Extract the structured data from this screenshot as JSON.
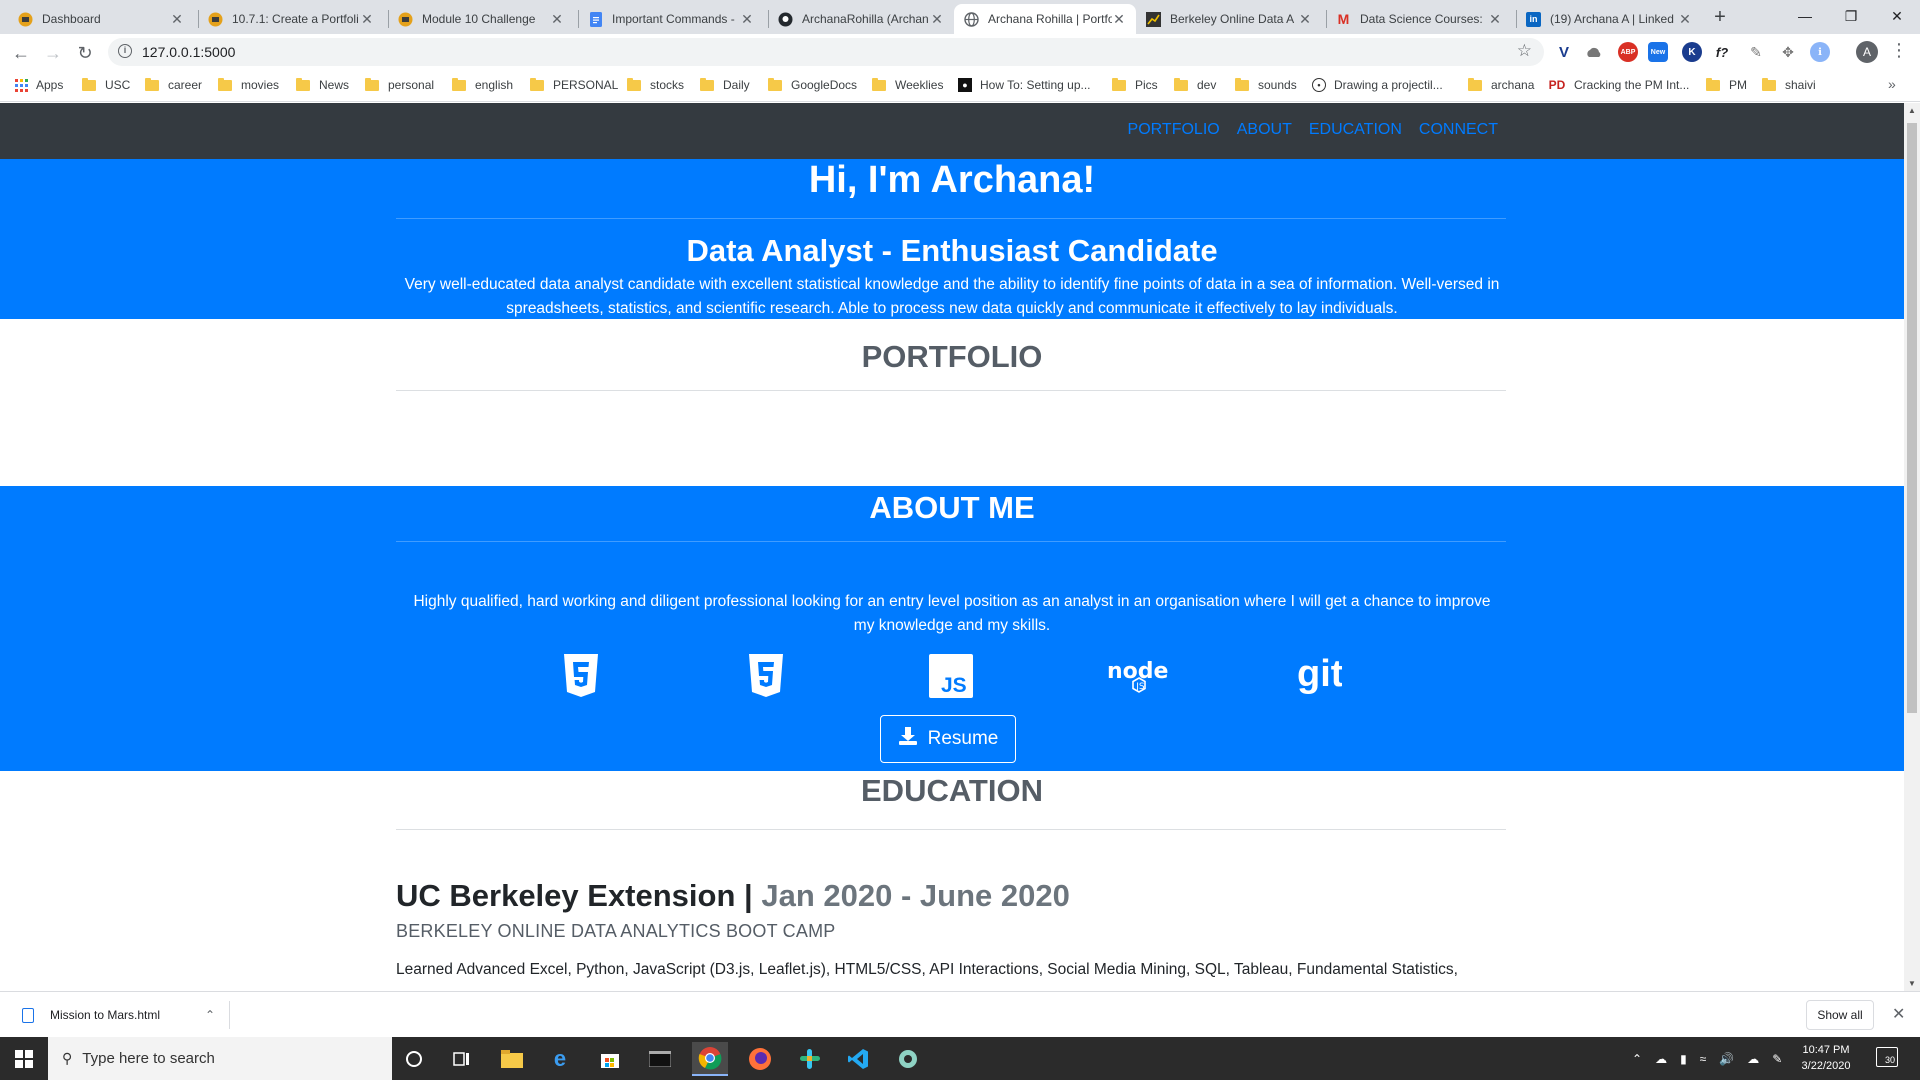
{
  "browser": {
    "tabs": [
      {
        "label": "Dashboard",
        "icon": "canvas-icon",
        "active": false
      },
      {
        "label": "10.7.1: Create a Portfoli",
        "icon": "canvas-icon",
        "active": false
      },
      {
        "label": "Module 10 Challenge",
        "icon": "canvas-icon",
        "active": false
      },
      {
        "label": "Important Commands -",
        "icon": "google-docs-icon",
        "active": false
      },
      {
        "label": "ArchanaRohilla (Archan",
        "icon": "github-icon",
        "active": false
      },
      {
        "label": "Archana Rohilla | Portfo",
        "icon": "globe-icon",
        "active": true
      },
      {
        "label": "Berkeley Online Data A",
        "icon": "chart-icon",
        "active": false
      },
      {
        "label": "Data Science Courses:",
        "icon": "gmail-icon",
        "active": false
      },
      {
        "label": "(19) Archana A | Linked",
        "icon": "linkedin-icon",
        "active": false
      }
    ],
    "url": "127.0.0.1:5000",
    "profile_initial": "A",
    "bookmarks": [
      {
        "label": "Apps",
        "type": "apps"
      },
      {
        "label": "USC",
        "type": "folder"
      },
      {
        "label": "career",
        "type": "folder"
      },
      {
        "label": "movies",
        "type": "folder"
      },
      {
        "label": "News",
        "type": "folder"
      },
      {
        "label": "personal",
        "type": "folder"
      },
      {
        "label": "english",
        "type": "folder"
      },
      {
        "label": "PERSONAL",
        "type": "folder"
      },
      {
        "label": "stocks",
        "type": "folder"
      },
      {
        "label": "Daily",
        "type": "folder"
      },
      {
        "label": "GoogleDocs",
        "type": "folder"
      },
      {
        "label": "Weeklies",
        "type": "folder"
      },
      {
        "label": "How To: Setting up...",
        "type": "page"
      },
      {
        "label": "Pics",
        "type": "folder"
      },
      {
        "label": "dev",
        "type": "folder"
      },
      {
        "label": "sounds",
        "type": "folder"
      },
      {
        "label": "Drawing a projectil...",
        "type": "page"
      },
      {
        "label": "archana",
        "type": "folder"
      },
      {
        "label": "Cracking the PM Int...",
        "type": "page"
      },
      {
        "label": "PM",
        "type": "folder"
      },
      {
        "label": "shaivi",
        "type": "folder"
      }
    ]
  },
  "site": {
    "nav": [
      "PORTFOLIO",
      "ABOUT",
      "EDUCATION",
      "CONNECT"
    ],
    "hero": {
      "greeting": "Hi, I'm Archana!",
      "role": "Data Analyst - Enthusiast Candidate",
      "summary": "Very well-educated data analyst candidate with excellent statistical knowledge and the ability to identify fine points of data in a sea of information. Well-versed in spreadsheets, statistics, and scientific research. Able to process new data quickly and communicate it effectively to lay individuals."
    },
    "portfolio": {
      "title": "PORTFOLIO"
    },
    "about": {
      "title": "ABOUT ME",
      "text": "Highly qualified, hard working and diligent professional looking for an entry level position as an analyst in an organisation where I will get a chance to improve my knowledge and my skills.",
      "skills": [
        "html5-icon",
        "css3-icon",
        "js-icon",
        "node-icon",
        "git-icon"
      ],
      "resume_label": "Resume"
    },
    "education": {
      "title": "EDUCATION",
      "school": "UC Berkeley Extension",
      "separator": "|",
      "dates": "Jan 2020 - June 2020",
      "program": "BERKELEY ONLINE DATA ANALYTICS BOOT CAMP",
      "description": "Learned Advanced Excel, Python, JavaScript (D3.js, Leaflet.js), HTML5/CSS, API Interactions, Social Media Mining, SQL, Tableau, Fundamental Statistics,"
    }
  },
  "downloads": {
    "file": "Mission to Mars.html",
    "show_all": "Show all"
  },
  "taskbar": {
    "search_placeholder": "Type here to search",
    "time": "10:47 PM",
    "date": "3/22/2020",
    "notifications": "30"
  },
  "colors": {
    "primary": "#007bff",
    "navbar": "#343a40"
  }
}
